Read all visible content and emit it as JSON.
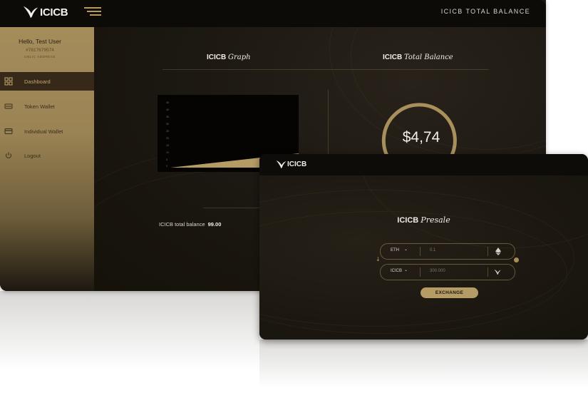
{
  "dashboard": {
    "brand": "ICICB",
    "header_title": "ICICB TOTAL BALANCE",
    "user": {
      "greeting": "Hello, Test User",
      "id": "#7817679574",
      "address_label": "UNLIC ADDRESS"
    },
    "nav": [
      {
        "label": "Dashboard",
        "icon": "dashboard-icon",
        "active": true
      },
      {
        "label": "Token Wallet",
        "icon": "token-wallet-icon",
        "active": false
      },
      {
        "label": "Individual Wallet",
        "icon": "card-icon",
        "active": false
      },
      {
        "label": "Logout",
        "icon": "power-icon",
        "active": false
      }
    ],
    "graph_section": {
      "title_prefix": "ICICB",
      "title_italic": "Graph"
    },
    "balance_section": {
      "title_prefix": "ICICB",
      "title_italic": "Total Balance"
    },
    "graph_y_ticks": [
      "45",
      "40",
      "35",
      "30",
      "25",
      "20",
      "15",
      "10",
      "5",
      "0"
    ],
    "balance_value": "$4,74",
    "total_balance": {
      "label": "ICICB total balance",
      "value": "99.00"
    },
    "colors": {
      "accent": "#b59b64",
      "dark": "#1b1711"
    }
  },
  "presale": {
    "brand": "ICICB",
    "title_prefix": "ICICB",
    "title_italic": "Presale",
    "from": {
      "currency": "ETH",
      "placeholder": "0.1",
      "icon": "ethereum-icon"
    },
    "to": {
      "currency": "ICICB",
      "placeholder": "300.000",
      "icon": "icicb-bird-icon"
    },
    "exchange_label": "EXCHANGE"
  }
}
